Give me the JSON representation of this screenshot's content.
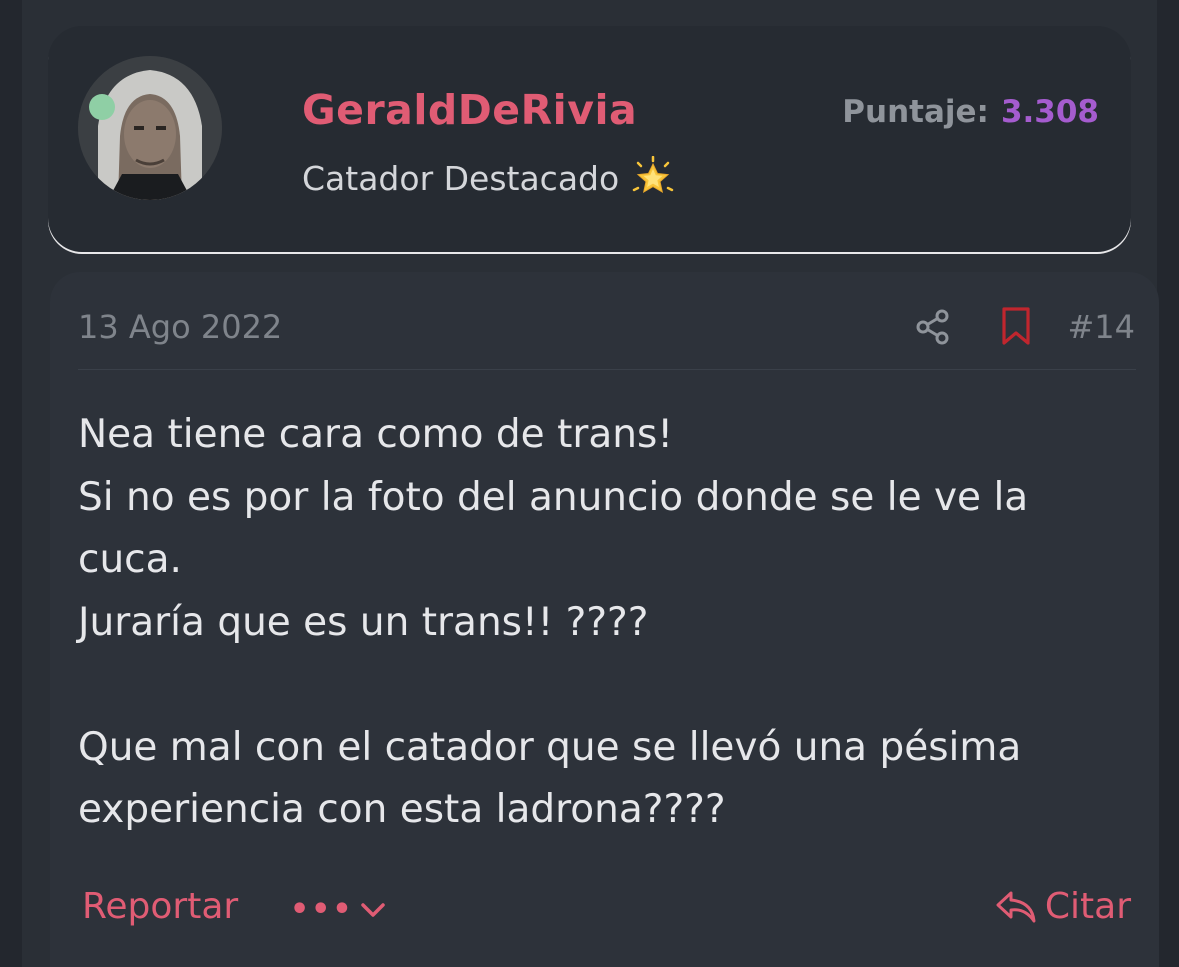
{
  "author": {
    "username": "GeraldDeRivia",
    "rank": "Catador Destacado",
    "rank_icon": "glowing-star-icon",
    "status": "online",
    "score_label": "Puntaje:",
    "score_value": "3.308"
  },
  "post": {
    "date": "13 Ago 2022",
    "number": "#14",
    "body_lines": [
      "Nea tiene cara como de trans!",
      "Si no es por la foto del anuncio donde se le ve la",
      "cuca.",
      "Juraría que es un trans!! ????",
      "",
      "Que mal con el catador que se llevó una pésima",
      "experiencia con esta ladrona????"
    ]
  },
  "actions": {
    "report_label": "Reportar",
    "more_label": "•••",
    "quote_label": "Citar"
  },
  "colors": {
    "accent": "#e05c74",
    "score": "#a55ccf",
    "online": "#8fcfa5",
    "bookmark": "#c0262e"
  }
}
